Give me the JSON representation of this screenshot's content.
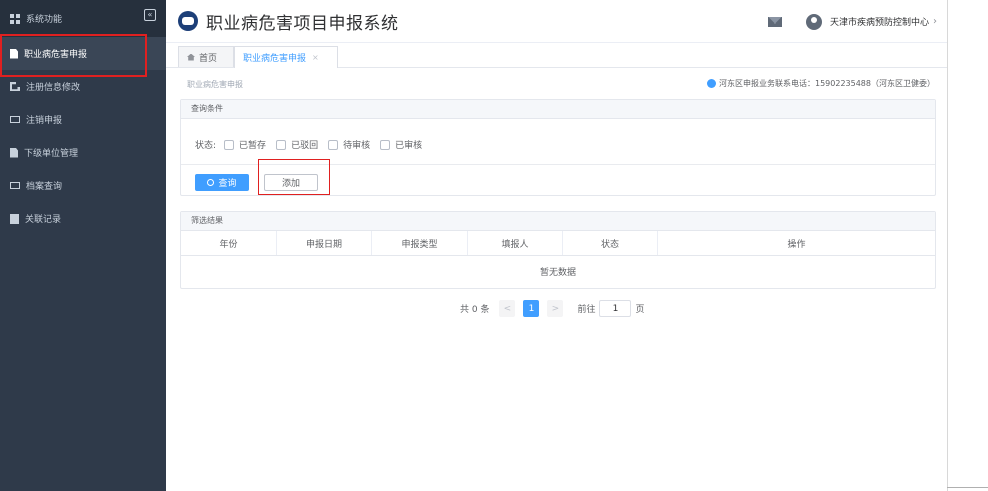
{
  "app": {
    "title": "职业病危害项目申报系统"
  },
  "user": {
    "name": "天津市疾病预防控制中心"
  },
  "sidebar": {
    "header_label": "系统功能",
    "items": [
      {
        "label": "职业病危害申报",
        "active": true
      },
      {
        "label": "注册信息修改"
      },
      {
        "label": "注销申报"
      },
      {
        "label": "下级单位管理"
      },
      {
        "label": "档案查询"
      },
      {
        "label": "关联记录"
      }
    ]
  },
  "tabs": [
    {
      "label": "首页"
    },
    {
      "label": "职业病危害申报",
      "close": "×"
    }
  ],
  "page": {
    "breadcrumb": "职业病危害申报",
    "hotline": "河东区申报业务联系电话：15902235488（河东区卫健委）"
  },
  "query": {
    "title": "查询条件",
    "status_label": "状态:",
    "options": [
      "已暂存",
      "已驳回",
      "待审核",
      "已审核"
    ],
    "search_button": "查询",
    "add_button": "添加"
  },
  "results": {
    "title": "筛选结果",
    "columns": [
      "年份",
      "申报日期",
      "申报类型",
      "填报人",
      "状态",
      "操作"
    ],
    "empty_text": "暂无数据"
  },
  "pagination": {
    "total_text": "共 0 条",
    "prev": "<",
    "current_page": "1",
    "next": ">",
    "goto_label": "前往",
    "goto_value": "1",
    "page_suffix": "页"
  },
  "colors": {
    "primary": "#409eff",
    "sidebar_bg": "#2f3a4a",
    "highlight": "#e02020"
  },
  "icons": [
    "grid-icon",
    "collapse-icon",
    "document-icon",
    "edit-icon",
    "mail-icon",
    "list-icon",
    "logo-icon",
    "envelope-icon",
    "avatar-icon",
    "home-icon",
    "phone-icon",
    "search-icon"
  ]
}
